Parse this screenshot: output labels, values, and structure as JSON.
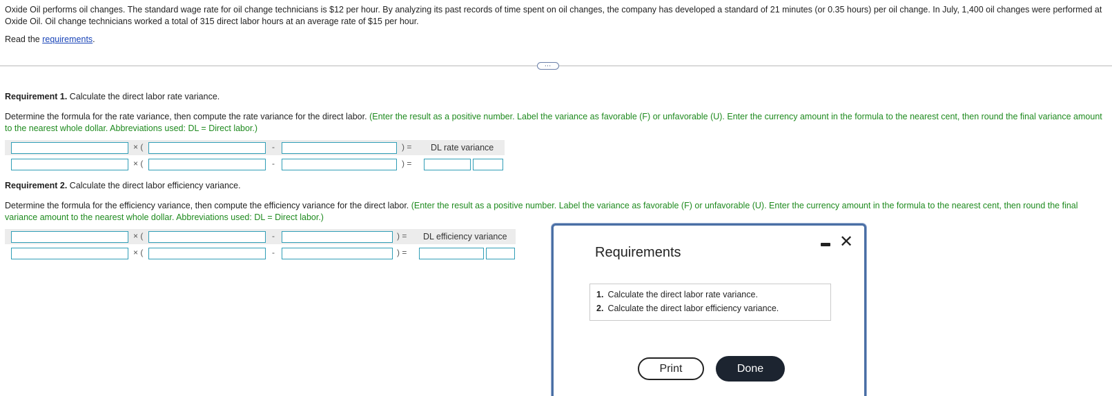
{
  "problem": {
    "text": "Oxide Oil performs oil changes. The standard wage rate for oil change technicians is $12 per hour. By analyzing its past records of time spent on oil changes, the company has developed a standard of 21 minutes (or 0.35 hours) per oil change. In July, 1,400 oil changes were performed at Oxide Oil. Oil change technicians worked a total of 315 direct labor hours at an average rate of $15 per hour.",
    "read_prefix": "Read the ",
    "read_link": "requirements",
    "read_suffix": "."
  },
  "more_button": "…",
  "req1": {
    "heading_bold": "Requirement 1.",
    "heading_text": " Calculate the direct labor rate variance.",
    "instr_plain": "Determine the formula for the rate variance, then compute the rate variance for the direct labor. ",
    "instr_green": "(Enter the result as a positive number. Label the variance as favorable (F) or unfavorable (U). Enter the currency amount in the formula to the nearest cent, then round the final variance amount to the nearest whole dollar. Abbreviations used: DL = Direct labor.)",
    "result_label": "DL rate variance"
  },
  "req2": {
    "heading_bold": "Requirement 2.",
    "heading_text": " Calculate the direct labor efficiency variance.",
    "instr_plain": "Determine the formula for the efficiency variance, then compute the efficiency variance for the direct labor. ",
    "instr_green": "(Enter the result as a positive number. Label the variance as favorable (F) or unfavorable (U). Enter the currency amount in the formula to the nearest cent, then round the final variance amount to the nearest whole dollar. Abbreviations used: DL = Direct labor.)",
    "result_label": "DL efficiency variance"
  },
  "symbols": {
    "times_open": "× (",
    "minus": "-",
    "close_eq": ")   ="
  },
  "modal": {
    "title": "Requirements",
    "items": [
      {
        "num": "1.",
        "text": "Calculate the direct labor rate variance."
      },
      {
        "num": "2.",
        "text": "Calculate the direct labor efficiency variance."
      }
    ],
    "print_label": "Print",
    "done_label": "Done"
  },
  "colors": {
    "accent": "#2f9db6",
    "green": "#1e8a1e",
    "link": "#1a45b8",
    "done_bg": "#1c2430"
  }
}
